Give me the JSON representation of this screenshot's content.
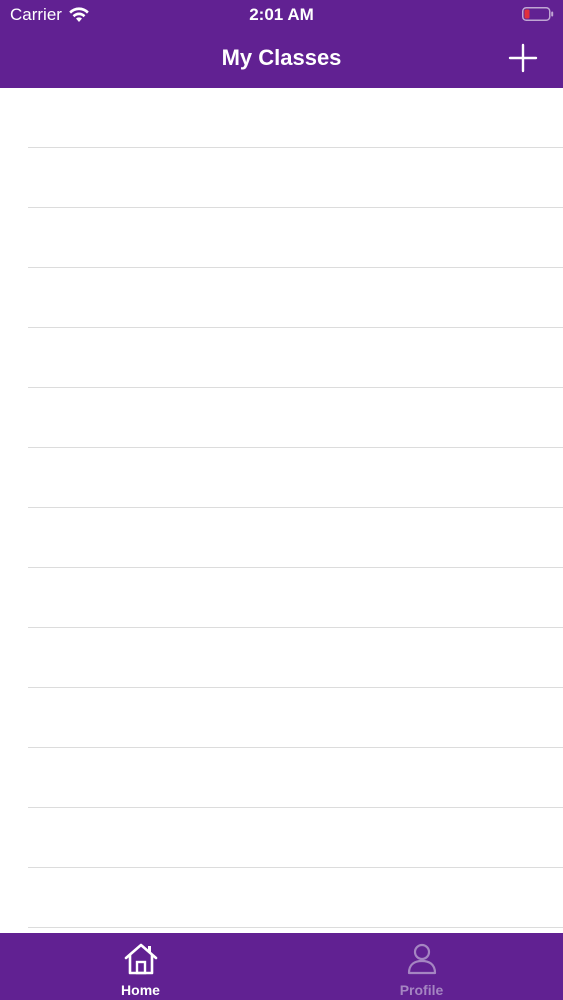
{
  "status_bar": {
    "carrier": "Carrier",
    "time": "2:01 AM"
  },
  "nav_bar": {
    "title": "My Classes",
    "add_icon": "plus-icon"
  },
  "class_list": {
    "rows": [
      "",
      "",
      "",
      "",
      "",
      "",
      "",
      "",
      "",
      "",
      "",
      "",
      "",
      ""
    ]
  },
  "tab_bar": {
    "tabs": [
      {
        "label": "Home",
        "icon": "home-icon",
        "selected": true
      },
      {
        "label": "Profile",
        "icon": "person-icon",
        "selected": false
      }
    ]
  },
  "colors": {
    "brand": "#612192",
    "tab_inactive": "#a585c2",
    "battery_low": "#e0303c",
    "separator": "#dcdcdc"
  }
}
